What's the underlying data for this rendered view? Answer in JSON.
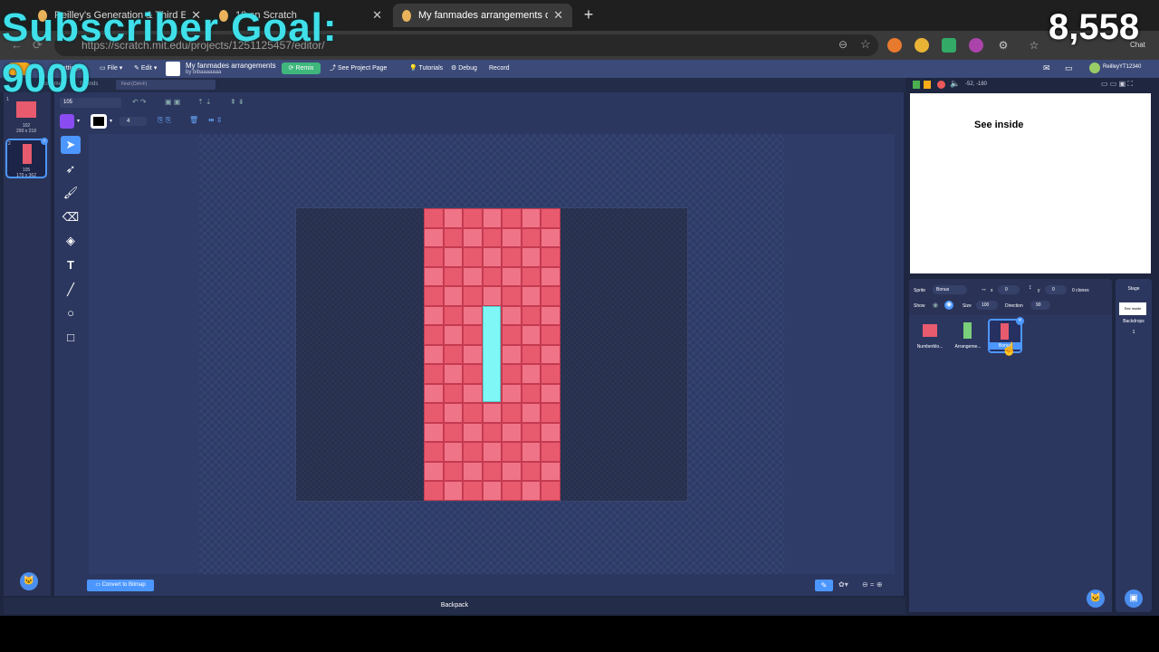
{
  "browser": {
    "tabs": [
      {
        "label": "Reilley's Generation & Third Editio"
      },
      {
        "label": "18 on Scratch"
      },
      {
        "label": "My fanmades arrangements on Sc"
      }
    ],
    "url": "https://scratch.mit.edu/projects/1251125457/editor/"
  },
  "menu": {
    "file": "File",
    "edit": "Edit",
    "project_title": "My fanmades arrangements",
    "author": "by bibaaaaaaa",
    "remix": "Remix",
    "see_project": "See Project Page",
    "tutorials": "Tutorials",
    "debug": "Debug",
    "record": "Record",
    "user": "ReilleyYT12340",
    "settings": "Settings",
    "chat": "Chat"
  },
  "editor_tabs": {
    "costumes": "Costumes",
    "sounds": "Sounds",
    "find": "Find (Ctrl+F)"
  },
  "costumes": [
    {
      "index": "1",
      "name": "102",
      "size": "290 x 218",
      "color": "#e85a6e"
    },
    {
      "index": "2",
      "name": "105",
      "size": "170 x 362",
      "color": "#e85a6e"
    }
  ],
  "paint": {
    "costume_name": "105",
    "outline_width": "4",
    "fill_color": "#8a4cf0",
    "outline_color": "#000000",
    "convert": "Convert to Bitmap",
    "grid_color": "#e85a6e",
    "grid_alt_color": "#f07487",
    "inner_color": "#7ff7f7"
  },
  "backpack": "Backpack",
  "stage": {
    "coords": "-52, -180",
    "text": "See inside"
  },
  "sprite_info": {
    "sprite_label": "Sprite",
    "sprite_name": "Bonus",
    "x_label": "x",
    "x_value": "0",
    "y_label": "y",
    "y_value": "0",
    "clones": "0 clones",
    "show_label": "Show",
    "size_label": "Size",
    "size_value": "100",
    "direction_label": "Direction",
    "direction_value": "90"
  },
  "sprites": [
    {
      "name": "Numberblo...",
      "color": "#e85a6e"
    },
    {
      "name": "Arrangeme...",
      "color": "#7ad07a"
    },
    {
      "name": "Bonus",
      "color": "#e85a6e"
    }
  ],
  "stage_pane": {
    "title": "Stage",
    "preview": "See inside",
    "backdrops": "Backdrops",
    "count": "1"
  },
  "overlay": {
    "sub_goal": "Subscriber Goal:",
    "goal_value": "9000",
    "count": "8,558"
  }
}
